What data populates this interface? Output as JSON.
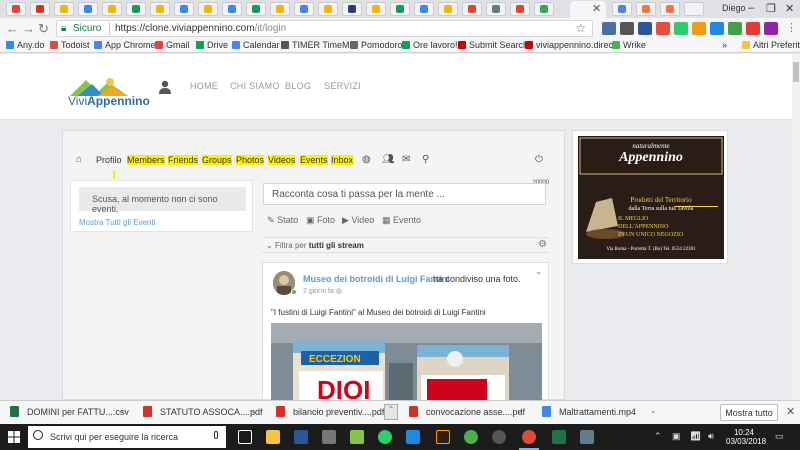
{
  "browser": {
    "profile_name": "Diego",
    "secure_label": "Sicuro",
    "url_host": "https://clone.viviappennino.com",
    "url_path": "/it/login"
  },
  "bookmarks": [
    {
      "label": "Any.do",
      "color": "#2a8ee8"
    },
    {
      "label": "Todoist",
      "color": "#db4c3f"
    },
    {
      "label": "App Chrome",
      "color": "#4285f4"
    },
    {
      "label": "Gmail",
      "color": "#ea4335"
    },
    {
      "label": "Drive",
      "color": "#0f9d58"
    },
    {
      "label": "Calendar",
      "color": "#4285f4"
    },
    {
      "label": "TIMER TimeMe",
      "color": "#555555"
    },
    {
      "label": "Pomodoro",
      "color": "#666666"
    },
    {
      "label": "Ore lavoro!",
      "color": "#0f9d58"
    },
    {
      "label": "Submit Search",
      "color": "#cc0000"
    },
    {
      "label": "viviappennino.directo",
      "color": "#cc0000"
    },
    {
      "label": "Wrike",
      "color": "#4caf50"
    },
    {
      "label": "Altri Preferiti",
      "color": "#f5c542"
    }
  ],
  "site": {
    "logo": {
      "prefix": "Vivi",
      "suffix": "Appennino"
    },
    "nav": [
      "HOME",
      "CHI SIAMO",
      "BLOG",
      "SERVIZI"
    ]
  },
  "social_nav": {
    "items": [
      {
        "label": "Profilo",
        "highlight": false
      },
      {
        "label": "Members",
        "highlight": true
      },
      {
        "label": "Friends",
        "highlight": true
      },
      {
        "label": "Groups",
        "highlight": true
      },
      {
        "label": "Photos",
        "highlight": true
      },
      {
        "label": "Videos",
        "highlight": true
      },
      {
        "label": "Events",
        "highlight": true
      },
      {
        "label": "Inbox",
        "highlight": true
      }
    ]
  },
  "events": {
    "empty_message": "Scusa, al momento non ci sono eventi.",
    "all_events_link": "Mostra Tutti gli Eventi"
  },
  "composer": {
    "placeholder": "Racconta cosa ti passa per la mente ...",
    "counter": "20000",
    "actions": [
      "Stato",
      "Foto",
      "Video",
      "Evento"
    ]
  },
  "filter": {
    "prefix": "Filtra per",
    "value": "tutti gli stream"
  },
  "post": {
    "author": "Museo dei botroidi di Luigi Fantini",
    "action": "ha condiviso una foto.",
    "time": "2 giorni fa",
    "caption": "\"I fustini di Luigi Fantini\" al Museo dei botroidi di Luigi Fantini",
    "photo_text_1": "ECCEZION",
    "photo_text_2": "DIOI"
  },
  "ad": {
    "line1": "naturalmente",
    "line2": "Appennino",
    "line3": "Prodotti del Territorio",
    "line4": "dalla Terra sulla tua Tavola",
    "line5": "IL MEGLIO",
    "line6": "DELL'APPENNINO",
    "line7": "IN UN UNICO NEGOZIO",
    "line8": "Via Roma - Porretta T. (Bo) Tel. 0534 22361"
  },
  "downloads": {
    "items": [
      {
        "name": "DOMINI per FATTU....csv",
        "color": "#217346"
      },
      {
        "name": "STATUTO ASSOCA....pdf",
        "color": "#d93025"
      },
      {
        "name": "bilancio preventiv....pdf",
        "color": "#d93025"
      },
      {
        "name": "convocazione asse....pdf",
        "color": "#d93025"
      },
      {
        "name": "Maltrattamenti.mp4",
        "color": "#4285f4"
      }
    ],
    "show_all": "Mostra tutto"
  },
  "taskbar": {
    "search_placeholder": "Scrivi qui per eseguire la ricerca",
    "time": "10:24",
    "date": "03/03/2018"
  }
}
